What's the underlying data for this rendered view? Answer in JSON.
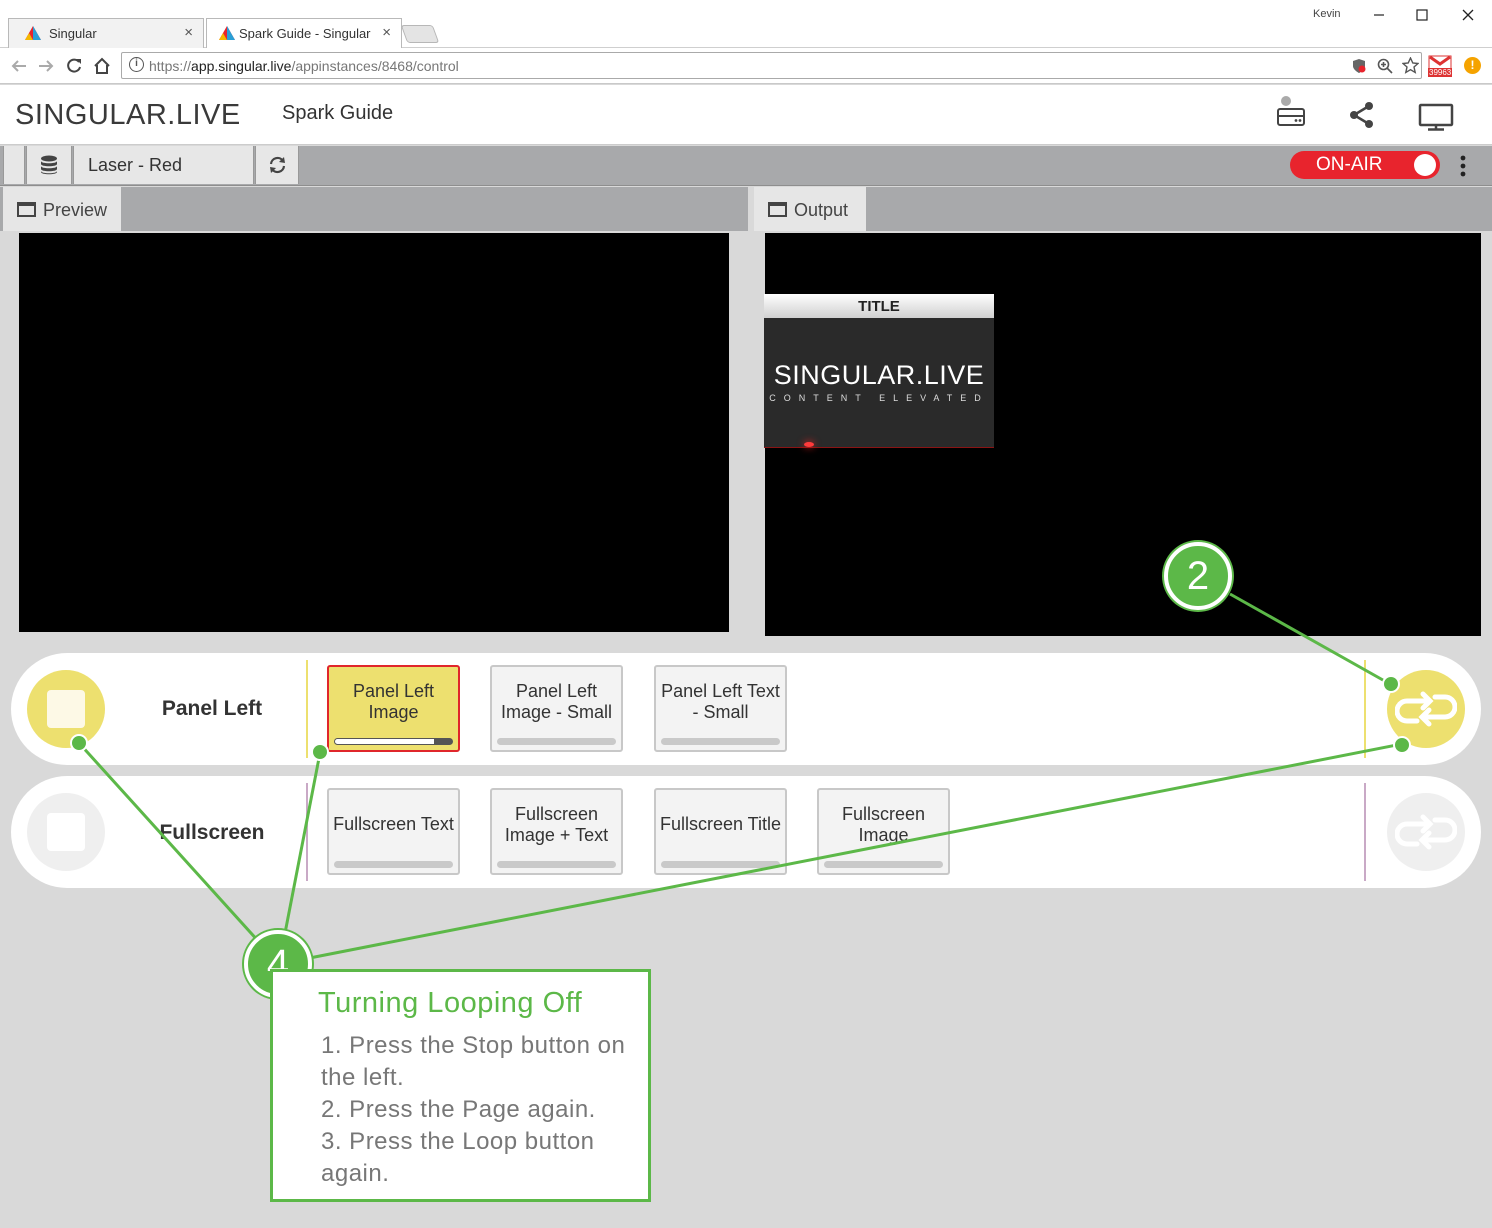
{
  "browser": {
    "tabs": [
      {
        "title": "Singular"
      },
      {
        "title": "Spark Guide - Singular"
      }
    ],
    "close_glyph": "×",
    "user": "Kevin",
    "url_prefix": "https://",
    "url_host": "app.singular.live",
    "url_path": "/appinstances/8468/control",
    "gmail_badge": "39963"
  },
  "app": {
    "logo": "SINGULAR.LIVE",
    "title": "Spark Guide",
    "composition": "Laser - Red",
    "on_air_label": "ON-AIR"
  },
  "panels": {
    "preview_label": "Preview",
    "output_label": "Output"
  },
  "output_graphic": {
    "title": "TITLE",
    "brand": "SINGULAR.LIVE",
    "tagline": "CONTENT ELEVATED"
  },
  "rows": [
    {
      "name": "Panel Left",
      "accent": "#ede06f",
      "cards": [
        "Panel Left Image",
        "Panel Left Image - Small",
        "Panel Left Text - Small"
      ],
      "active_card": "Panel Left Image"
    },
    {
      "name": "Fullscreen",
      "accent": "#c9a9c6",
      "cards": [
        "Fullscreen Text",
        "Fullscreen Image + Text",
        "Fullscreen Title",
        "Fullscreen Image"
      ]
    }
  ],
  "annotations": {
    "badge_2": "2",
    "badge_4": "4",
    "callout_title": "Turning Looping Off",
    "steps": [
      "1. Press the Stop button on the left.",
      "2. Press the Page again.",
      "3. Press the Loop button again."
    ],
    "color": "#5cb848"
  }
}
